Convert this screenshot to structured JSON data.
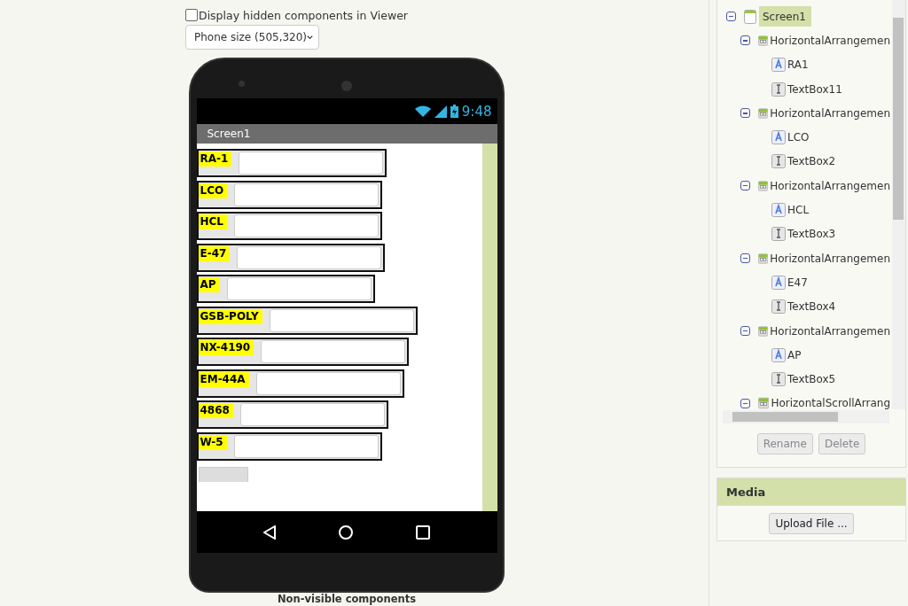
{
  "viewer": {
    "hidden_toggle": {
      "label": "Display hidden components in Viewer",
      "checked": false
    },
    "size_select": {
      "value": "Phone size (505,320)"
    },
    "phone": {
      "clock": "9:48",
      "screen_title": "Screen1",
      "rows": [
        {
          "label": "RA-1"
        },
        {
          "label": "LCO"
        },
        {
          "label": "HCL"
        },
        {
          "label": "E-47"
        },
        {
          "label": "AP"
        },
        {
          "label": "GSB-POLY"
        },
        {
          "label": "NX-4190"
        },
        {
          "label": "EM-44A"
        },
        {
          "label": "4868"
        },
        {
          "label": "W-5"
        }
      ]
    },
    "non_visible_title": "Non-visible components"
  },
  "components": {
    "tree": [
      {
        "kind": "screen",
        "label": "Screen1",
        "selected": true,
        "expanded": true,
        "children": [
          {
            "kind": "arrangement",
            "label": "HorizontalArrangemen",
            "selected": false,
            "expanded": true,
            "children": [
              {
                "kind": "label",
                "label": "RA1",
                "selected": false
              },
              {
                "kind": "textbox",
                "label": "TextBox11",
                "selected": false
              }
            ]
          },
          {
            "kind": "arrangement",
            "label": "HorizontalArrangemen",
            "selected": false,
            "expanded": true,
            "children": [
              {
                "kind": "label",
                "label": "LCO",
                "selected": false
              },
              {
                "kind": "textbox",
                "label": "TextBox2",
                "selected": false
              }
            ]
          },
          {
            "kind": "arrangement",
            "label": "HorizontalArrangemen",
            "selected": false,
            "expanded": true,
            "children": [
              {
                "kind": "label",
                "label": "HCL",
                "selected": false
              },
              {
                "kind": "textbox",
                "label": "TextBox3",
                "selected": false
              }
            ]
          },
          {
            "kind": "arrangement",
            "label": "HorizontalArrangemen",
            "selected": false,
            "expanded": true,
            "children": [
              {
                "kind": "label",
                "label": "E47",
                "selected": false
              },
              {
                "kind": "textbox",
                "label": "TextBox4",
                "selected": false
              }
            ]
          },
          {
            "kind": "arrangement",
            "label": "HorizontalArrangemen",
            "selected": false,
            "expanded": true,
            "children": [
              {
                "kind": "label",
                "label": "AP",
                "selected": false
              },
              {
                "kind": "textbox",
                "label": "TextBox5",
                "selected": false
              }
            ]
          },
          {
            "kind": "arrangement",
            "label": "HorizontalScrollArrang",
            "selected": false,
            "expanded": true
          }
        ]
      }
    ],
    "buttons": [
      {
        "label": "Rename",
        "disabled": true
      },
      {
        "label": "Delete",
        "disabled": true
      }
    ]
  },
  "media": {
    "title": "Media",
    "upload_button": "Upload File ..."
  }
}
